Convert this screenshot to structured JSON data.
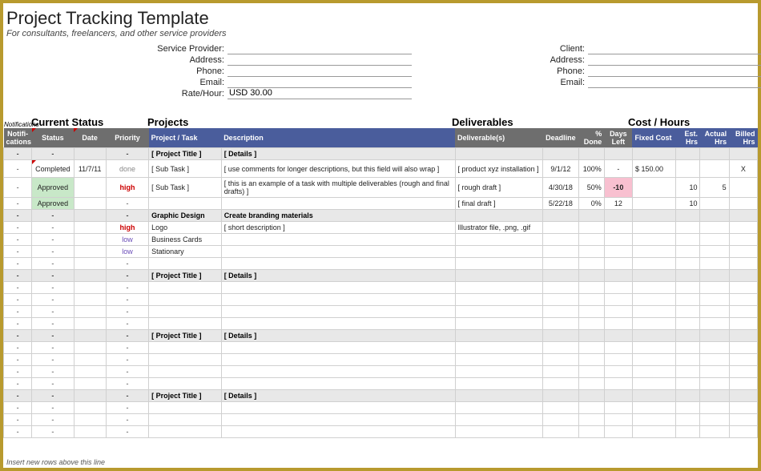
{
  "title": "Project Tracking Template",
  "subtitle": "For consultants, freelancers, and other service providers",
  "provider": {
    "label_sp": "Service Provider:",
    "label_addr": "Address:",
    "label_phone": "Phone:",
    "label_email": "Email:",
    "label_rate": "Rate/Hour:",
    "rate": "USD 30.00"
  },
  "client": {
    "label_client": "Client:",
    "label_addr": "Address:",
    "label_phone": "Phone:",
    "label_email": "Email:"
  },
  "sections": {
    "notif": "Notifications",
    "status": "Current Status",
    "projects": "Projects",
    "deliverables": "Deliverables",
    "cost": "Cost / Hours"
  },
  "headers": {
    "notif": "Notifi-cations",
    "status": "Status",
    "date": "Date",
    "priority": "Priority",
    "task": "Project / Task",
    "desc": "Description",
    "deliv": "Deliverable(s)",
    "deadline": "Deadline",
    "done": "% Done",
    "days": "Days Left",
    "fixed": "Fixed Cost",
    "est": "Est. Hrs",
    "act": "Actual Hrs",
    "billed": "Billed Hrs"
  },
  "placeholders": {
    "project_title": "[ Project Title ]",
    "details": "[ Details ]"
  },
  "rows": [
    {
      "type": "section",
      "task": "[ Project Title ]",
      "desc": "[ Details ]"
    },
    {
      "type": "data",
      "status": "Completed",
      "date": "11/7/11",
      "priority": "done",
      "task": "[ Sub Task ]",
      "desc": "[ use comments for longer descriptions, but this field will also wrap ]",
      "deliv": "[ product xyz installation ]",
      "deadline": "9/1/12",
      "done": "100%",
      "days": "-",
      "fixed": "$      150.00",
      "billed": "X",
      "tall": true,
      "redmark": true
    },
    {
      "type": "data",
      "status": "Approved",
      "status_class": "status-approved",
      "priority": "high",
      "priority_class": "priority-high",
      "task": "[ Sub Task ]",
      "desc": "[ this is an example of a task with multiple deliverables (rough and final drafts) ]",
      "deliv": "[ rough draft ]",
      "deadline": "4/30/18",
      "done": "50%",
      "days": "-10",
      "days_class": "days-neg",
      "est": "10",
      "act": "5",
      "tall": true
    },
    {
      "type": "data",
      "status": "Approved",
      "status_class": "status-approved",
      "deliv": "[ final draft ]",
      "deadline": "5/22/18",
      "done": "0%",
      "days": "12",
      "est": "10"
    },
    {
      "type": "section",
      "task": "Graphic Design",
      "desc": "Create branding materials"
    },
    {
      "type": "data",
      "priority": "high",
      "priority_class": "priority-high",
      "task": "Logo",
      "desc": "[ short description ]",
      "deliv": "Illustrator file, .png, .gif"
    },
    {
      "type": "data",
      "priority": "low",
      "priority_class": "priority-low",
      "task": "Business Cards"
    },
    {
      "type": "data",
      "priority": "low",
      "priority_class": "priority-low",
      "task": "Stationary"
    },
    {
      "type": "data"
    },
    {
      "type": "section",
      "task": "[ Project Title ]",
      "desc": "[ Details ]"
    },
    {
      "type": "data"
    },
    {
      "type": "data"
    },
    {
      "type": "data"
    },
    {
      "type": "data"
    },
    {
      "type": "section",
      "task": "[ Project Title ]",
      "desc": "[ Details ]"
    },
    {
      "type": "data"
    },
    {
      "type": "data"
    },
    {
      "type": "data"
    },
    {
      "type": "data"
    },
    {
      "type": "section",
      "task": "[ Project Title ]",
      "desc": "[ Details ]"
    },
    {
      "type": "data"
    },
    {
      "type": "data"
    },
    {
      "type": "data"
    }
  ],
  "footer": "Insert new rows above this line"
}
